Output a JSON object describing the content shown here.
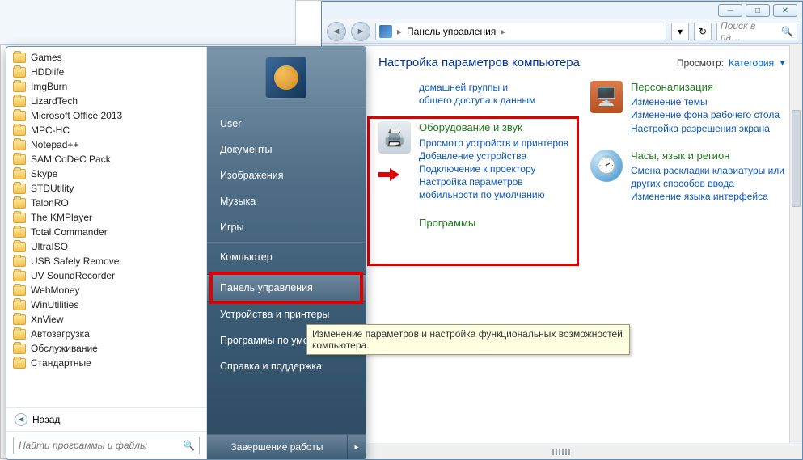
{
  "window_buttons": {
    "min": "─",
    "max": "□",
    "close": "✕"
  },
  "address": {
    "root_label": "Панель управления",
    "sep": "▸"
  },
  "toolbar": {
    "refresh": "↻",
    "search_placeholder": "Поиск в па…"
  },
  "cp": {
    "heading": "Настройка параметров компьютера",
    "view_label": "Просмотр:",
    "view_value": "Категория",
    "left_fragment": {
      "l1": "домашней группы и",
      "l2": "общего доступа к данным"
    },
    "hardware": {
      "title": "Оборудование и звук",
      "links": [
        "Просмотр устройств и принтеров",
        "Добавление устройства",
        "Подключение к проектору",
        "Настройка параметров мобильности по умолчанию"
      ]
    },
    "programs_fragment": "Программы",
    "personalization": {
      "title": "Персонализация",
      "links": [
        "Изменение темы",
        "Изменение фона рабочего стола",
        "Настройка разрешения экрана"
      ]
    },
    "clock": {
      "title": "Часы, язык и регион",
      "links": [
        "Смена раскладки клавиатуры или других способов ввода",
        "Изменение языка интерфейса"
      ]
    }
  },
  "start": {
    "programs": [
      "Games",
      "HDDlife",
      "ImgBurn",
      "LizardTech",
      "Microsoft Office 2013",
      "MPC-HC",
      "Notepad++",
      "SAM CoDeC Pack",
      "Skype",
      "STDUtility",
      "TalonRO",
      "The KMPlayer",
      "Total Commander",
      "UltraISO",
      "USB Safely Remove",
      "UV SoundRecorder",
      "WebMoney",
      "WinUtilities",
      "XnView",
      "Автозагрузка",
      "Обслуживание",
      "Стандартные"
    ],
    "back": "Назад",
    "search_placeholder": "Найти программы и файлы",
    "right": {
      "user": "User",
      "documents": "Документы",
      "pictures": "Изображения",
      "music": "Музыка",
      "games": "Игры",
      "computer": "Компьютер",
      "control_panel": "Панель управления",
      "devices": "Устройства и принтеры",
      "default_programs": "Программы по умолчанию",
      "help": "Справка и поддержка"
    },
    "shutdown": "Завершение работы"
  },
  "tooltip": "Изменение параметров и настройка функциональных возможностей компьютера."
}
